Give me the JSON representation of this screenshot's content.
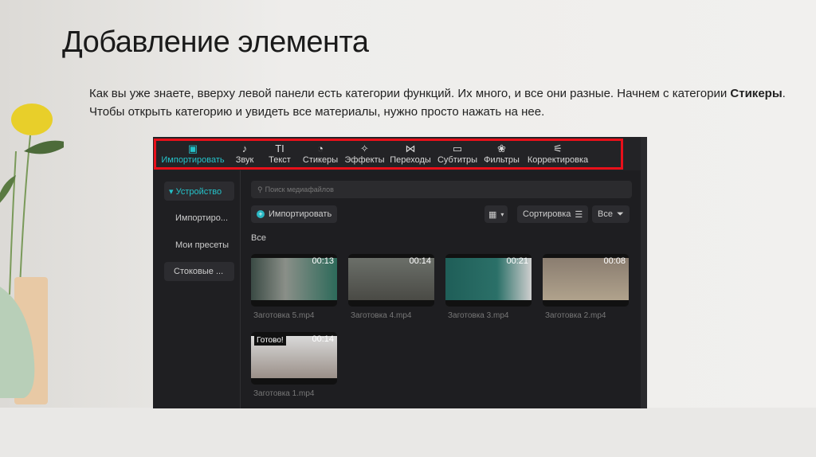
{
  "slide": {
    "title": "Добавление элемента",
    "para_1": "Как вы уже знаете, вверху левой панели есть категории функций. Их много, и все они разные. Начнем с категории ",
    "para_bold": "Стикеры",
    "para_2": ". Чтобы открыть категорию и увидеть все материалы, нужно просто нажать на нее."
  },
  "app": {
    "tabs": [
      {
        "icon": "▣",
        "label": "Импортировать"
      },
      {
        "icon": "♪",
        "label": "Звук"
      },
      {
        "icon": "TI",
        "label": "Текст"
      },
      {
        "icon": "◔",
        "label": "Стикеры"
      },
      {
        "icon": "✧",
        "label": "Эффекты"
      },
      {
        "icon": "⋈",
        "label": "Переходы"
      },
      {
        "icon": "▭",
        "label": "Субтитры"
      },
      {
        "icon": "❀",
        "label": "Фильтры"
      },
      {
        "icon": "⚟",
        "label": "Корректировка"
      }
    ],
    "sidebar": [
      "▾ Устройство",
      "Импортиро...",
      "Мои пресеты",
      "Стоковые ..."
    ],
    "search_placeholder": "Поиск медиафайлов",
    "import_button": "Импортировать",
    "sort_button": "Сортировка",
    "filter_button": "Все",
    "section_label": "Все",
    "ready_badge": "Готово!",
    "media": [
      {
        "name": "Заготовка 5.mp4",
        "duration": "00:13"
      },
      {
        "name": "Заготовка 4.mp4",
        "duration": "00:14"
      },
      {
        "name": "Заготовка 3.mp4",
        "duration": "00:21"
      },
      {
        "name": "Заготовка 2.mp4",
        "duration": "00:08"
      },
      {
        "name": "Заготовка 1.mp4",
        "duration": "00:14"
      }
    ]
  },
  "colors": {
    "accent": "#25c2c9",
    "highlight": "#e8101a"
  }
}
